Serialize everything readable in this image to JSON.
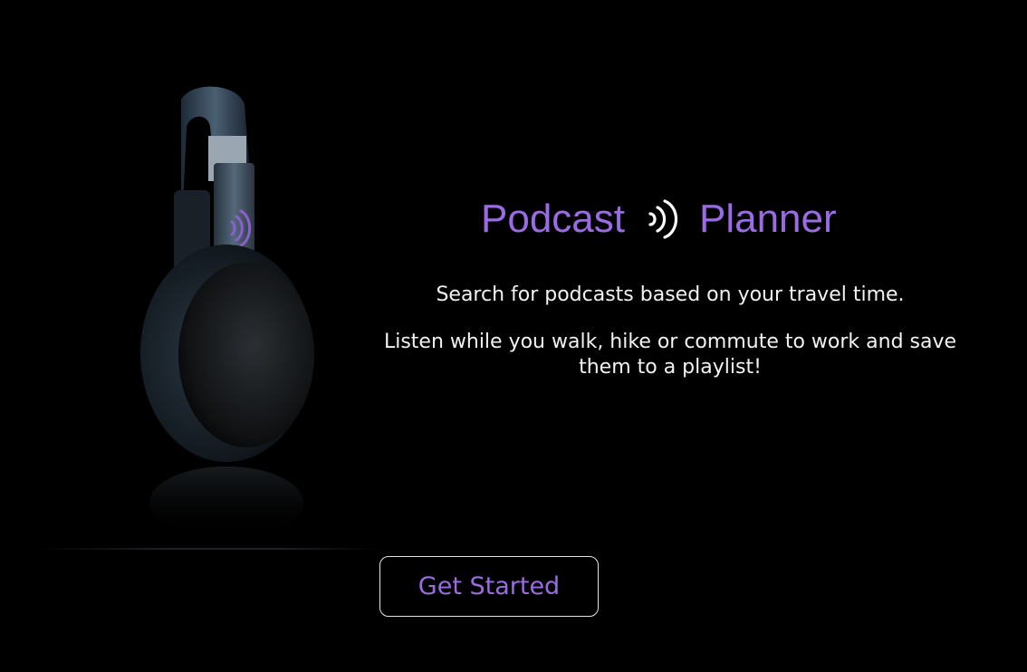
{
  "hero": {
    "image": "headphones-icon",
    "accent_color": "#9b6be3"
  },
  "header": {
    "title_part1": "Podcast",
    "title_icon": "broadcast-waves-icon",
    "title_part2": "Planner"
  },
  "description": {
    "line1": "Search for podcasts based on your travel time.",
    "line2": "Listen while you walk, hike or commute to work and save them to a playlist!"
  },
  "cta": {
    "label": "Get Started"
  },
  "colors": {
    "background": "#000000",
    "accent": "#9b6be3",
    "text": "#f2f2f2",
    "button_border": "#e6e6e6"
  }
}
